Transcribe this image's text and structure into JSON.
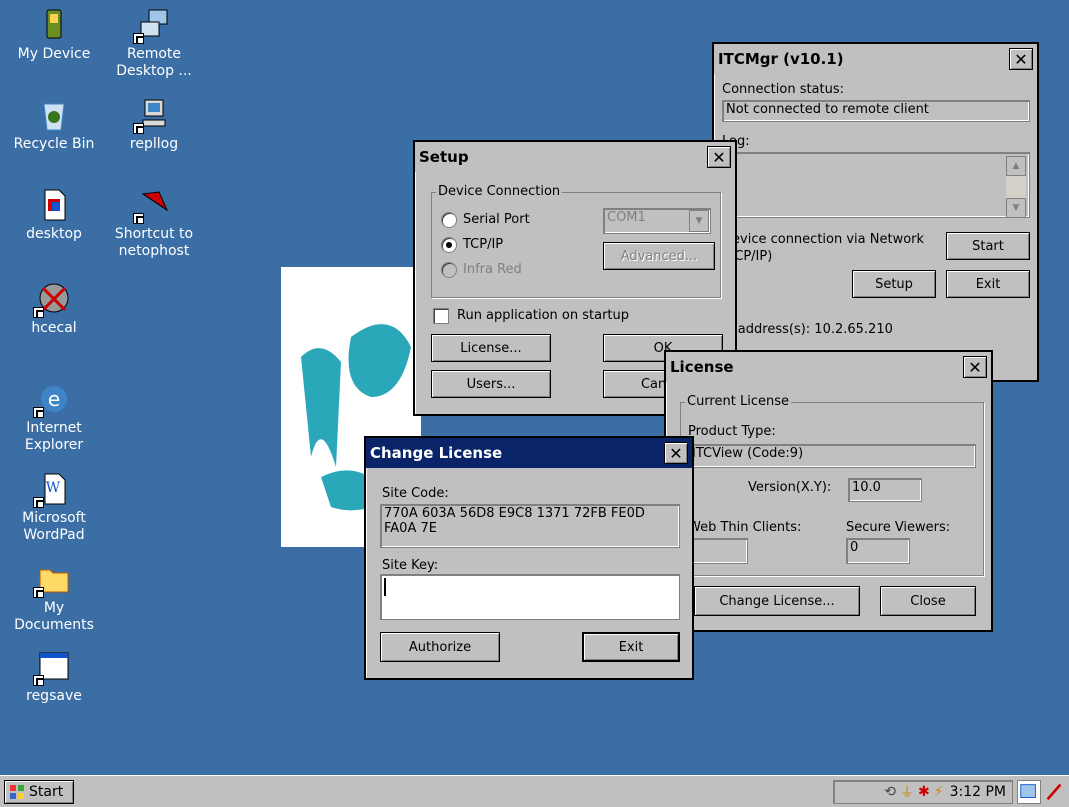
{
  "desktop": {
    "icons": [
      {
        "label": "My Device"
      },
      {
        "label": "Remote Desktop ..."
      },
      {
        "label": "Recycle Bin"
      },
      {
        "label": "repllog"
      },
      {
        "label": "desktop"
      },
      {
        "label": "Shortcut to netophost"
      },
      {
        "label": "hcecal"
      },
      {
        "label": "Internet Explorer"
      },
      {
        "label": "Microsoft WordPad"
      },
      {
        "label": "My Documents"
      },
      {
        "label": "regsave"
      }
    ]
  },
  "itcmgr": {
    "title": "ITCMgr (v10.1)",
    "connection_status_label": "Connection status:",
    "connection_status_value": "Not connected to remote client",
    "log_label": "Log:",
    "device_connection_text_line1": "Device connection via Network",
    "device_connection_text_line2": "(TCP/IP)",
    "start_label": "Start",
    "setup_label": "Setup",
    "exit_label": "Exit",
    "ip_label": "IP address(s): 10.2.65.210"
  },
  "setup": {
    "title": "Setup",
    "group_title": "Device Connection",
    "serial_port": "Serial Port",
    "tcpip": "TCP/IP",
    "infra_red": "Infra Red",
    "com_value": "COM1",
    "advanced_label": "Advanced...",
    "run_on_startup": "Run application on startup",
    "license_label": "License...",
    "ok_label": "OK",
    "users_label": "Users...",
    "cancel_label": "Cancel"
  },
  "license": {
    "title": "License",
    "group_title": "Current License",
    "product_type_label": "Product Type:",
    "product_type_value": "ITCView (Code:9)",
    "version_label": "Version(X.Y):",
    "version_value": "10.0",
    "web_thin_clients_label": "Web Thin Clients:",
    "web_thin_clients_value": "",
    "secure_viewers_label": "Secure Viewers:",
    "secure_viewers_value": "0",
    "change_license_label": "Change License...",
    "close_label": "Close"
  },
  "change_license": {
    "title": "Change License",
    "site_code_label": "Site Code:",
    "site_code_line1": "770A 603A 56D8 E9C8 1371 72FB FE0D",
    "site_code_line2": "FA0A 7E",
    "site_key_label": "Site Key:",
    "site_key_value": "",
    "authorize_label": "Authorize",
    "exit_label": "Exit"
  },
  "taskbar": {
    "start_label": "Start",
    "clock": "3:12 PM"
  },
  "colors": {
    "desktop": "#3a6ea5",
    "active_title": "#0a246a",
    "window": "#c0c0c0"
  }
}
